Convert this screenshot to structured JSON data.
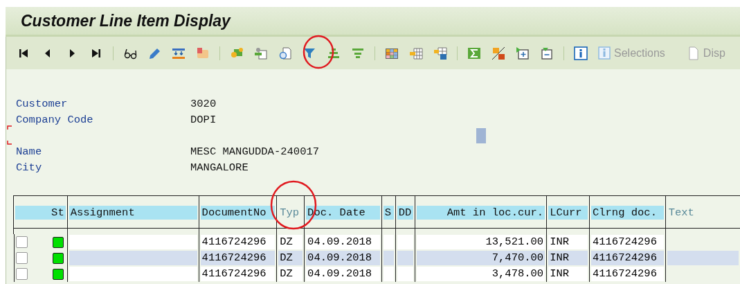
{
  "window": {
    "title": "Customer Line Item Display"
  },
  "toolbar": {
    "text_buttons": [
      {
        "label": "Selections",
        "disabled": true
      },
      {
        "label": "Disp",
        "disabled": true
      }
    ]
  },
  "header_fields": [
    {
      "label": "Customer",
      "value": "3020"
    },
    {
      "label": "Company Code",
      "value": "DOPI"
    },
    {
      "label": "Name",
      "value": "MESC MANGUDDA-240017"
    },
    {
      "label": "City",
      "value": "MANGALORE"
    }
  ],
  "table": {
    "columns": [
      {
        "label": "St",
        "highlighted": true
      },
      {
        "label": "Assignment",
        "highlighted": true
      },
      {
        "label": "DocumentNo",
        "highlighted": true
      },
      {
        "label": "Typ",
        "highlighted": false
      },
      {
        "label": "Doc. Date",
        "highlighted": true
      },
      {
        "label": "S",
        "highlighted": true
      },
      {
        "label": "DD",
        "highlighted": true
      },
      {
        "label": "Amt in loc.cur.",
        "highlighted": true
      },
      {
        "label": "LCurr",
        "highlighted": true
      },
      {
        "label": "Clrng doc.",
        "highlighted": true
      },
      {
        "label": "Text",
        "highlighted": false
      }
    ],
    "rows": [
      {
        "checked": false,
        "color": "#00e000",
        "assignment": "",
        "document_no": "4116724296",
        "typ": "DZ",
        "doc_date": "04.09.2018",
        "amount": "13,521.00",
        "lcurr": "INR",
        "clrng_doc": "4116724296"
      },
      {
        "checked": false,
        "color": "#00e000",
        "assignment": "",
        "document_no": "4116724296",
        "typ": "DZ",
        "doc_date": "04.09.2018",
        "amount": "7,470.00",
        "lcurr": "INR",
        "clrng_doc": "4116724296"
      },
      {
        "checked": false,
        "color": "#00e000",
        "assignment": "",
        "document_no": "4116724296",
        "typ": "DZ",
        "doc_date": "04.09.2018",
        "amount": "3,478.00",
        "lcurr": "INR",
        "clrng_doc": "4116724296"
      }
    ]
  }
}
